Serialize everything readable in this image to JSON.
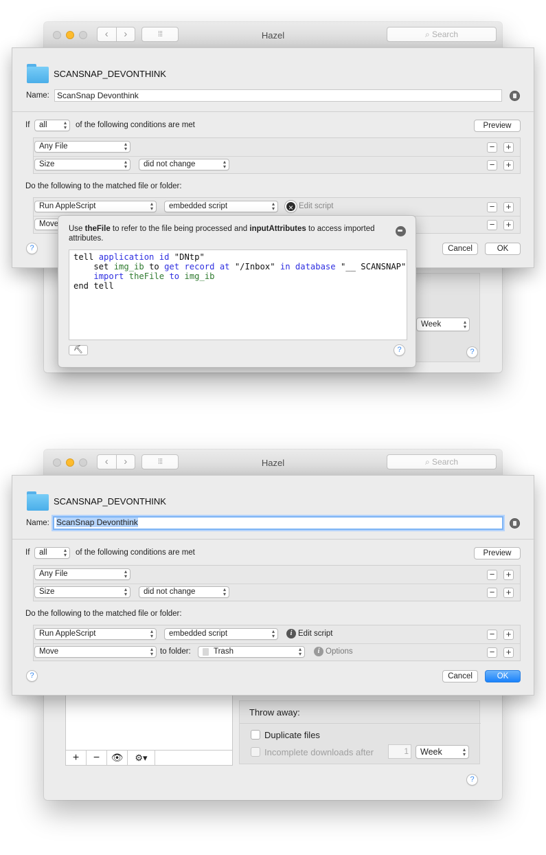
{
  "app": {
    "title": "Hazel",
    "search_placeholder": "Search"
  },
  "rule": {
    "folder_name": "SCANSNAP_DEVONTHINK",
    "name_label": "Name:",
    "name_value": "ScanSnap Devonthink",
    "if_label": "If",
    "match_mode": "all",
    "conditions_suffix": "of the following conditions are met",
    "preview_label": "Preview",
    "conditions": [
      {
        "attribute": "Any File",
        "operator": ""
      },
      {
        "attribute": "Size",
        "operator": "did not change"
      }
    ],
    "actions_heading": "Do the following to the matched file or folder:",
    "actions": [
      {
        "action": "Run AppleScript",
        "target": "embedded script",
        "extra": "Edit script"
      },
      {
        "action": "Move",
        "to_label": "to folder:",
        "folder": "Trash",
        "extra": "Options"
      }
    ],
    "cancel_label": "Cancel",
    "ok_label": "OK",
    "plus": "+",
    "minus": "−"
  },
  "popover": {
    "hint_1": "Use ",
    "hint_b1": "theFile",
    "hint_2": " to refer to the file being processed and ",
    "hint_b2": "inputAttributes",
    "hint_3": " to access imported attributes.",
    "script": {
      "l1_a": "tell ",
      "l1_b": "application",
      "l1_c": " ",
      "l1_d": "id",
      "l1_e": " \"DNtp\"",
      "l2_a": "    set ",
      "l2_b": "img_ib",
      "l2_c": " to ",
      "l2_d": "get record",
      "l2_e": " ",
      "l2_f": "at",
      "l2_g": " \"/Inbox\" ",
      "l2_h": "in",
      "l2_i": " ",
      "l2_j": "database",
      "l2_k": " \"__ SCANSNAP\"",
      "l3_a": "    ",
      "l3_b": "import",
      "l3_c": " ",
      "l3_d": "theFile",
      "l3_e": " ",
      "l3_f": "to",
      "l3_g": " ",
      "l3_h": "img_ib",
      "l4": "end tell"
    }
  },
  "background": {
    "throw_away_label": "Throw away:",
    "duplicate_label": "Duplicate files",
    "incomplete_label": "Incomplete downloads after",
    "incomplete_value": "1",
    "period": "Week"
  },
  "icons": [
    "folder-icon",
    "document-icon",
    "help-icon",
    "info-icon",
    "close-icon",
    "hammer-icon",
    "eye-icon",
    "gear-icon",
    "search-icon"
  ]
}
